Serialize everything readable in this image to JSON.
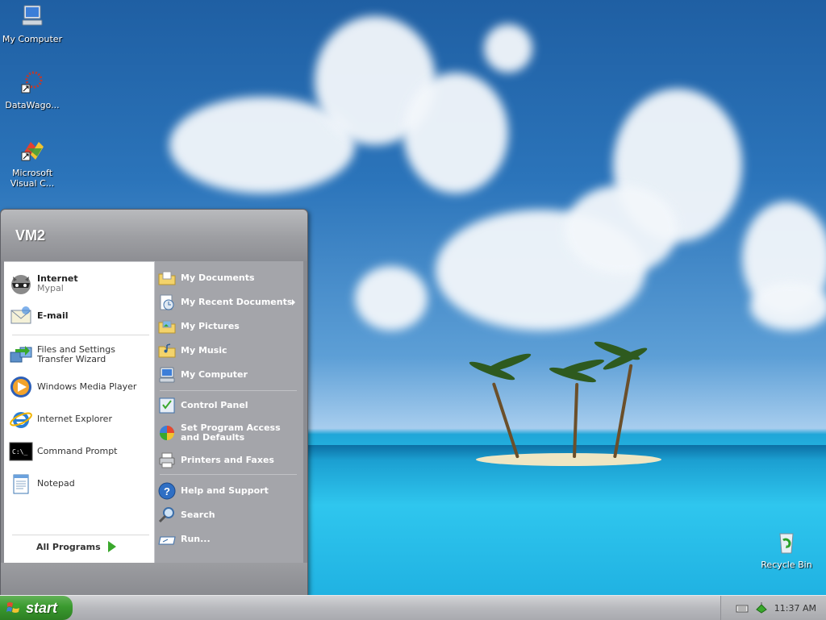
{
  "desktop": {
    "icons": [
      {
        "label": "My Computer",
        "icon": "my-computer-icon"
      },
      {
        "label": "DataWago...",
        "icon": "datawagon-icon"
      },
      {
        "label": "Microsoft Visual C...",
        "icon": "visual-studio-icon"
      },
      {
        "label": "Recycle Bin",
        "icon": "recycle-bin-icon"
      }
    ]
  },
  "start_menu": {
    "user": "VM2",
    "left_items": [
      {
        "title": "Internet",
        "subtitle": "Mypal",
        "icon": "mypal-raccoon-icon"
      },
      {
        "title": "E-mail",
        "subtitle": "",
        "icon": "email-envelope-icon"
      },
      {
        "title": "Files and Settings Transfer Wizard",
        "icon": "transfer-wizard-icon"
      },
      {
        "title": "Windows Media Player",
        "icon": "media-player-icon"
      },
      {
        "title": "Internet Explorer",
        "icon": "internet-explorer-icon"
      },
      {
        "title": "Command Prompt",
        "icon": "command-prompt-icon"
      },
      {
        "title": "Notepad",
        "icon": "notepad-icon"
      }
    ],
    "all_programs": "All Programs",
    "right_items": [
      {
        "label": "My Documents",
        "icon": "folder-documents-icon"
      },
      {
        "label": "My Recent Documents",
        "icon": "recent-documents-icon"
      },
      {
        "label": "My Pictures",
        "icon": "folder-pictures-icon"
      },
      {
        "label": "My Music",
        "icon": "folder-music-icon"
      },
      {
        "label": "My Computer",
        "icon": "my-computer-icon"
      },
      {
        "label": "Control Panel",
        "icon": "control-panel-icon"
      },
      {
        "label": "Set Program Access and Defaults",
        "icon": "program-defaults-icon"
      },
      {
        "label": "Printers and Faxes",
        "icon": "printer-icon"
      },
      {
        "label": "Help and Support",
        "icon": "help-icon"
      },
      {
        "label": "Search",
        "icon": "search-icon"
      },
      {
        "label": "Run...",
        "icon": "run-icon"
      }
    ]
  },
  "taskbar": {
    "start_label": "start",
    "clock": "11:37 AM"
  }
}
